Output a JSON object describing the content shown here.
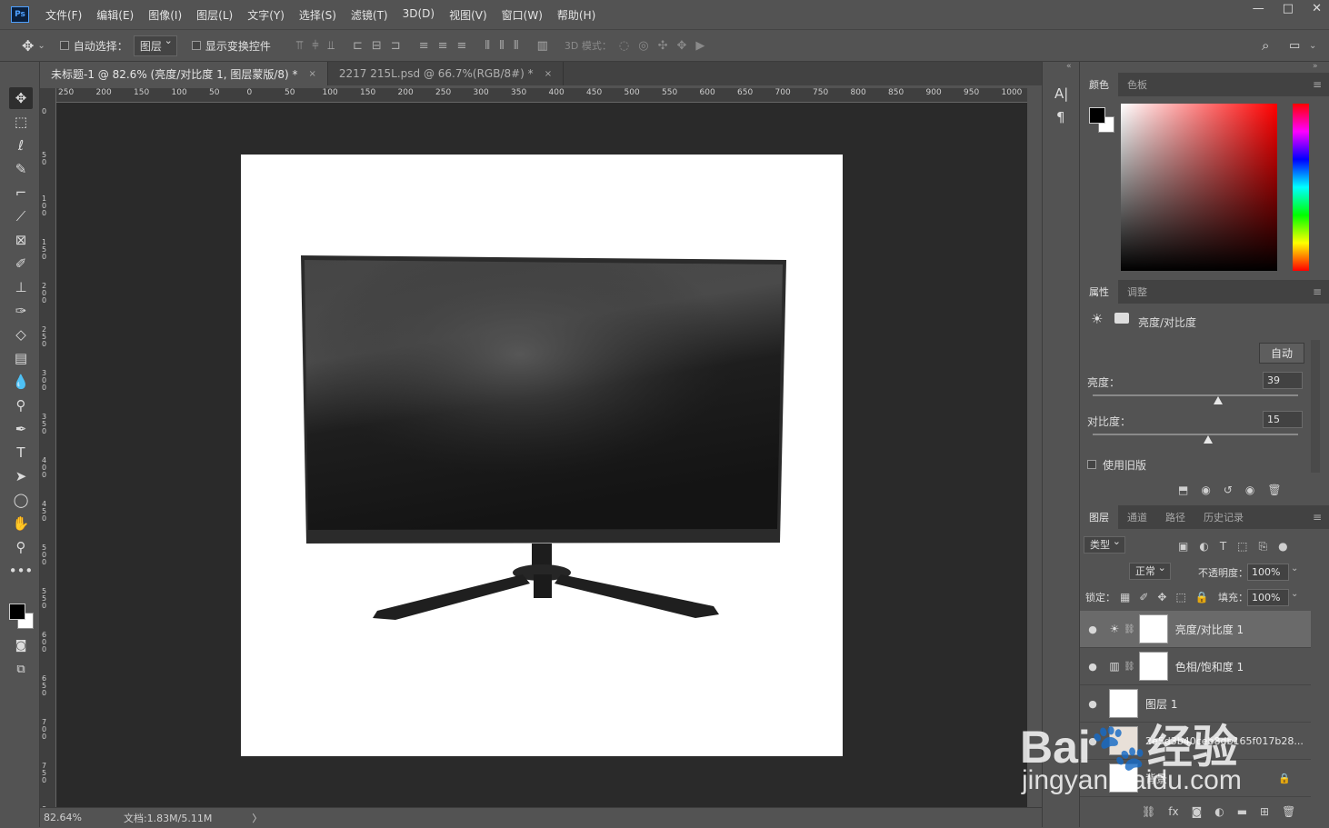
{
  "app": {
    "logo": "Ps"
  },
  "menu": [
    "文件(F)",
    "编辑(E)",
    "图像(I)",
    "图层(L)",
    "文字(Y)",
    "选择(S)",
    "滤镜(T)",
    "3D(D)",
    "视图(V)",
    "窗口(W)",
    "帮助(H)"
  ],
  "window_controls": {
    "minimize": "—",
    "maximize": "□",
    "close": "✕"
  },
  "options": {
    "auto_select_label": "自动选择：",
    "auto_select_value": "图层",
    "transform_label": "显示变换控件",
    "mode_3d": "3D 模式："
  },
  "tabs": [
    {
      "label": "未标题-1 @ 82.6% (亮度/对比度 1, 图层蒙版/8) *",
      "close": "×"
    },
    {
      "label": "2217 215L.psd @ 66.7%(RGB/8#) *",
      "close": "×"
    }
  ],
  "ruler_h": [
    "250",
    "200",
    "150",
    "100",
    "50",
    "0",
    "50",
    "100",
    "150",
    "200",
    "250",
    "300",
    "350",
    "400",
    "450",
    "500",
    "550",
    "600",
    "650",
    "700",
    "750",
    "800",
    "850",
    "900",
    "950",
    "1000"
  ],
  "ruler_v": [
    "0",
    "5 0",
    "1 0 0",
    "1 5 0",
    "2 0 0",
    "2 5 0",
    "3 0 0",
    "3 5 0",
    "4 0 0",
    "4 5 0",
    "5 0 0",
    "5 5 0",
    "6 0 0",
    "6 5 0",
    "7 0 0",
    "7 5 0",
    "8 0 0"
  ],
  "status": {
    "zoom": "82.64%",
    "doc": "文档:1.83M/5.11M",
    "arrow": "〉"
  },
  "color_panel": {
    "tabs": [
      "颜色",
      "色板"
    ],
    "fg": "#000000",
    "bg": "#ffffff"
  },
  "properties": {
    "tabs": [
      "属性",
      "调整"
    ],
    "title": "亮度/对比度",
    "auto_button": "自动",
    "brightness_label": "亮度：",
    "brightness_value": "39",
    "brightness_fraction": 0.61,
    "contrast_label": "对比度：",
    "contrast_value": "15",
    "contrast_fraction": 0.56,
    "legacy_label": "使用旧版"
  },
  "layers_panel": {
    "tabs": [
      "图层",
      "通道",
      "路径",
      "历史记录"
    ],
    "filter": "类型",
    "blend": "正常",
    "opacity_label": "不透明度：",
    "opacity": "100%",
    "lock_label": "锁定：",
    "fill_label": "填充：",
    "fill": "100%",
    "layers": [
      {
        "name": "亮度/对比度 1"
      },
      {
        "name": "色相/饱和度 1"
      },
      {
        "name": "图层 1"
      },
      {
        "name": "2e5d3b40ceb8db165f017b28..."
      },
      {
        "name": "背景"
      }
    ]
  },
  "watermark": {
    "brand_a": "Bai",
    "brand_b": "经验",
    "url": "jingyan.baidu.com"
  }
}
